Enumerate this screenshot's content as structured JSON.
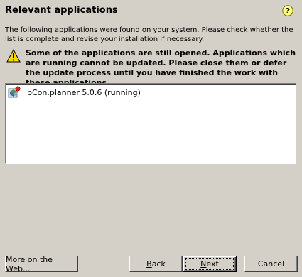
{
  "header": {
    "title": "Relevant applications",
    "help_icon": "question-mark-help-icon"
  },
  "description": "The following applications were found on your system. Please check whether the list is complete and revise your installation if necessary.",
  "warning": {
    "icon": "warning-triangle-icon",
    "text": "Some of the applications are still opened. Applications which are running cannot be updated. Please close them or defer the update process until you have finished the work with these applications."
  },
  "applications": [
    {
      "icon": "pcon-planner-app-icon",
      "label": "pCon.planner 5.0.6 (running)"
    }
  ],
  "buttons": {
    "web": "More on the Web...",
    "back_first": "B",
    "back_rest": "ack",
    "next_first": "N",
    "next_rest": "ext",
    "cancel": "Cancel"
  },
  "colors": {
    "dialog_background": "#d4d0c8",
    "list_background": "#ffffff",
    "warning_yellow": "#ffd700",
    "help_yellow": "#ffff80"
  }
}
